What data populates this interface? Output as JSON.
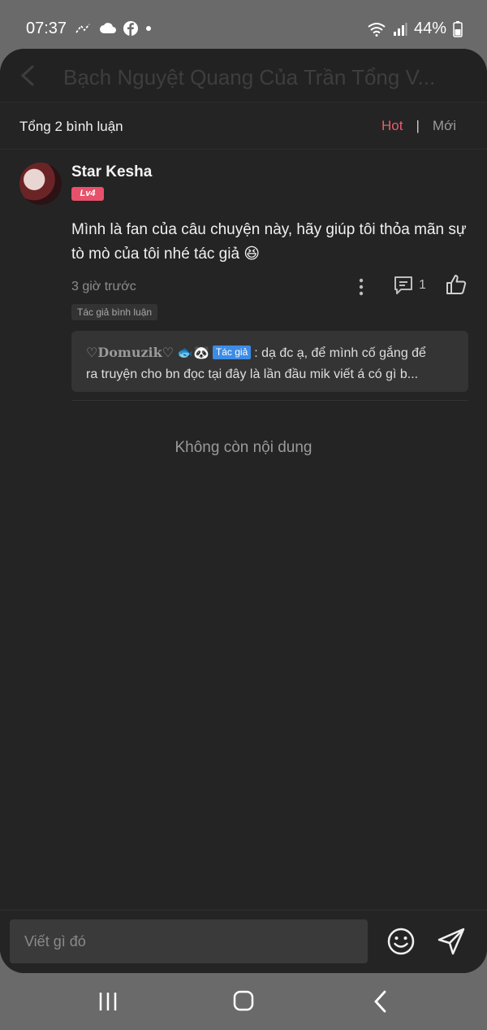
{
  "status_bar": {
    "time": "07:37",
    "battery": "44%"
  },
  "header": {
    "book_title": "Bạch Nguyệt Quang Của Trần Tổng V..."
  },
  "comments_header": {
    "total": "Tổng 2 bình luận",
    "tab_hot": "Hot",
    "separator": "|",
    "tab_new": "Mới"
  },
  "comment": {
    "username": "Star Kesha",
    "level": "Lv4",
    "text": "Mình là fan của câu chuyện này, hãy giúp tôi thỏa mãn sự tò mò của tôi nhé tác giả 😆",
    "time": "3 giờ trước",
    "reply_count": "1",
    "author_tag": "Tác giả bình luận",
    "reply": {
      "name": "♡Domuzik♡",
      "emoji": "🐟🐼",
      "badge": "Tác giả",
      "text_line1": ": dạ đc ạ, để mình cố gắng để",
      "text_line2": "ra truyện cho bn đọc tại đây là lần đầu mik viết á có gì b..."
    }
  },
  "end_message": "Không còn nội dung",
  "input": {
    "placeholder": "Viết gì đó"
  },
  "colors": {
    "accent": "#e85d6c",
    "background": "#242424",
    "author_badge": "#3c8ce7",
    "level_badge": "#e8516a"
  }
}
